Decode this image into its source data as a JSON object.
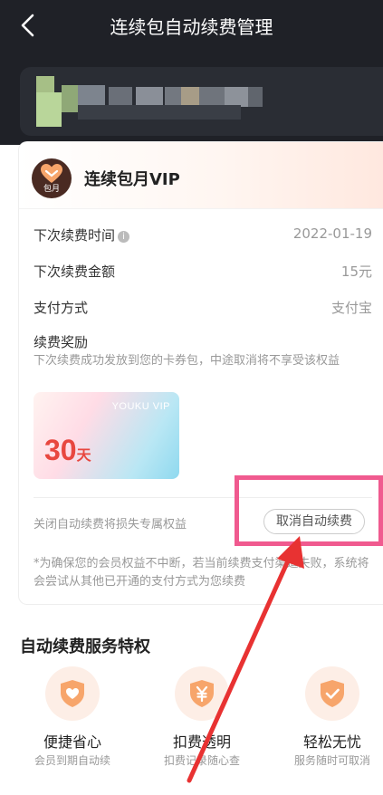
{
  "header": {
    "title": "连续包自动续费管理"
  },
  "plan": {
    "logo_text": "包月",
    "name": "连续包月VIP"
  },
  "details": [
    {
      "label": "下次续费时间",
      "value": "2022-01-19"
    },
    {
      "label": "下次续费金额",
      "value": "15元"
    },
    {
      "label": "支付方式",
      "value": "支付宝"
    }
  ],
  "info_icon": "i",
  "reward": {
    "title": "续费奖励",
    "description": "下次续费成功发放到您的卡券包，中途取消将不享受该权益",
    "coupon_brand": "YOUKU VIP",
    "coupon_days": "30",
    "coupon_unit": "天"
  },
  "cancel": {
    "warning": "关闭自动续费将损失专属权益",
    "button_label": "取消自动续费"
  },
  "note": "*为确保您的会员权益不中断，若当前续费支付渠道失败，系统将会尝试从其他已开通的支付方式为您续费",
  "perks_section": {
    "title": "自动续费服务特权",
    "items": [
      {
        "name": "便捷省心",
        "desc": "会员到期自动续",
        "icon": "heart-shield-icon"
      },
      {
        "name": "扣费透明",
        "desc": "扣费记录随心查",
        "icon": "yen-shield-icon"
      },
      {
        "name": "轻松无忧",
        "desc": "服务随时可取消",
        "icon": "check-shield-icon"
      }
    ]
  },
  "colors": {
    "header_bg": "#1f2127",
    "accent_orange": "#f7a56b",
    "coupon_red": "#e8473f",
    "highlight_pink": "#f05a8f",
    "arrow_red": "#e83232"
  }
}
